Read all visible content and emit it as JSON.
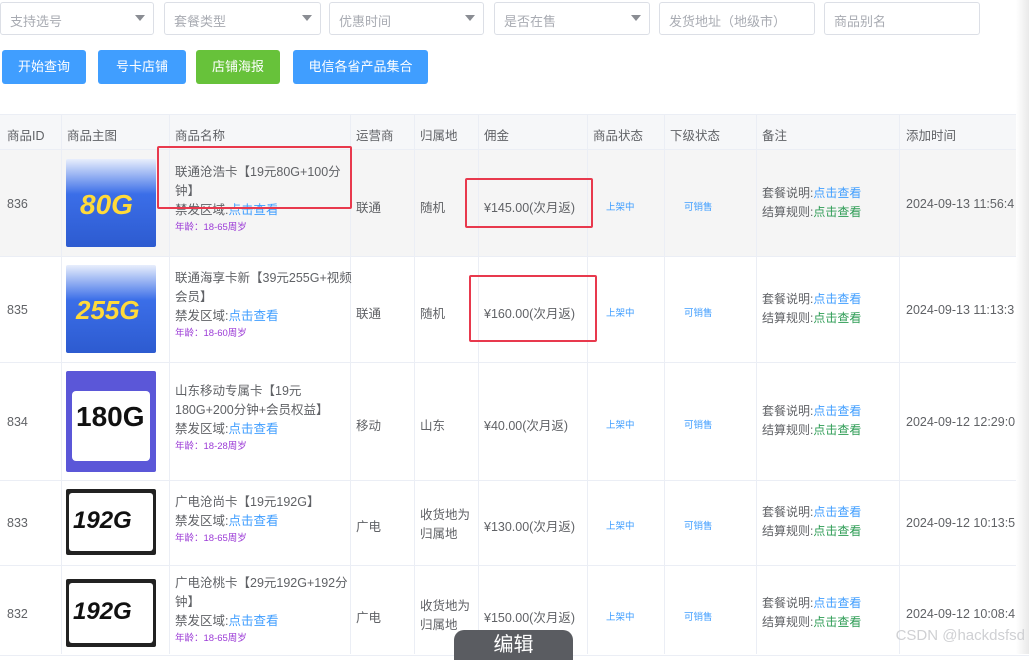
{
  "filters": [
    {
      "placeholder": "支持选号",
      "dropdown": true
    },
    {
      "placeholder": "套餐类型",
      "dropdown": true
    },
    {
      "placeholder": "优惠时间",
      "dropdown": true
    },
    {
      "placeholder": "是否在售",
      "dropdown": true
    },
    {
      "placeholder": "发货地址（地级市）",
      "dropdown": false
    },
    {
      "placeholder": "商品别名",
      "dropdown": false
    }
  ],
  "buttons": {
    "query": "开始查询",
    "shop": "号卡店铺",
    "poster": "店铺海报",
    "collection": "电信各省产品集合"
  },
  "columns": [
    "商品ID",
    "商品主图",
    "商品名称",
    "运营商",
    "归属地",
    "佣金",
    "商品状态",
    "下级状态",
    "备注",
    "添加时间"
  ],
  "rows": [
    {
      "id": "836",
      "name": "联通沧浩卡【19元80G+100分钟】",
      "zone_label": "禁发区域:",
      "zone_link": "点击查看",
      "age": "年龄：18-65周岁",
      "operator": "联通",
      "region": "随机",
      "commission": "¥145.00(次月返)",
      "status": "上架中",
      "sub_status": "可销售",
      "note1_label": "套餐说明:",
      "note1_link": "点击查看",
      "note2_label": "结算规则:",
      "note2_link": "点击查看",
      "added": "2024-09-13 11:56:4",
      "thumb_text": "80G",
      "thumb_style": "blue"
    },
    {
      "id": "835",
      "name": "联通海享卡新【39元255G+视频会员】",
      "zone_label": "禁发区域:",
      "zone_link": "点击查看",
      "age": "年龄：18-60周岁",
      "operator": "联通",
      "region": "随机",
      "commission": "¥160.00(次月返)",
      "status": "上架中",
      "sub_status": "可销售",
      "note1_label": "套餐说明:",
      "note1_link": "点击查看",
      "note2_label": "结算规则:",
      "note2_link": "点击查看",
      "added": "2024-09-13 11:13:3",
      "thumb_text": "255G",
      "thumb_style": "blue"
    },
    {
      "id": "834",
      "name": "山东移动专属卡【19元180G+200分钟+会员权益】",
      "zone_label": "禁发区域:",
      "zone_link": "点击查看",
      "age": "年龄：18-28周岁",
      "operator": "移动",
      "region": "山东",
      "commission": "¥40.00(次月返)",
      "status": "上架中",
      "sub_status": "可销售",
      "note1_label": "套餐说明:",
      "note1_link": "点击查看",
      "note2_label": "结算规则:",
      "note2_link": "点击查看",
      "added": "2024-09-12 12:29:0",
      "thumb_text": "180G",
      "thumb_style": "purple"
    },
    {
      "id": "833",
      "name": "广电沧尚卡【19元192G】",
      "zone_label": "禁发区域:",
      "zone_link": "点击查看",
      "age": "年龄：18-65周岁",
      "operator": "广电",
      "region": "收货地为归属地",
      "commission": "¥130.00(次月返)",
      "status": "上架中",
      "sub_status": "可销售",
      "note1_label": "套餐说明:",
      "note1_link": "点击查看",
      "note2_label": "结算规则:",
      "note2_link": "点击查看",
      "added": "2024-09-12 10:13:5",
      "thumb_text": "192G",
      "thumb_style": "dark"
    },
    {
      "id": "832",
      "name": "广电沧桃卡【29元192G+192分钟】",
      "zone_label": "禁发区域:",
      "zone_link": "点击查看",
      "age": "年龄：18-65周岁",
      "operator": "广电",
      "region": "收货地为归属地",
      "commission": "¥150.00(次月返)",
      "status": "上架中",
      "sub_status": "可销售",
      "note1_label": "套餐说明:",
      "note1_link": "点击查看",
      "note2_label": "结算规则:",
      "note2_link": "点击查看",
      "added": "2024-09-12 10:08:4",
      "thumb_text": "192G",
      "thumb_style": "dark"
    }
  ],
  "edit_label": "编辑",
  "watermark": "CSDN @hackdsfsd",
  "colors": {
    "primary": "#409eff",
    "success": "#67c23a",
    "highlight_box": "#e8394d"
  }
}
